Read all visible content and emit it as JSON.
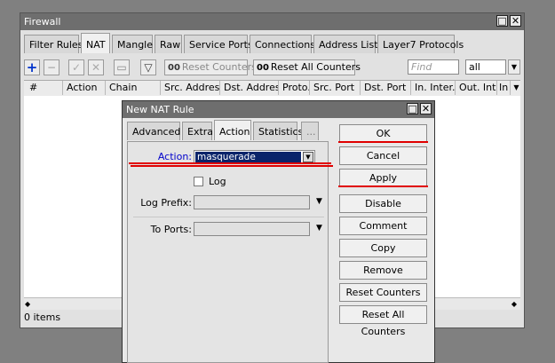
{
  "main_window": {
    "title": "Firewall",
    "tabs": [
      {
        "label": "Filter Rules"
      },
      {
        "label": "NAT"
      },
      {
        "label": "Mangle"
      },
      {
        "label": "Raw"
      },
      {
        "label": "Service Ports"
      },
      {
        "label": "Connections"
      },
      {
        "label": "Address Lists"
      },
      {
        "label": "Layer7 Protocols"
      }
    ],
    "active_tab": "NAT",
    "toolbar": {
      "reset_counters": "Reset Counters",
      "reset_all_counters": "Reset All Counters",
      "counter_prefix": "00",
      "find_placeholder": "Find",
      "filter_value": "all"
    },
    "columns": [
      "#",
      "Action",
      "Chain",
      "Src. Address",
      "Dst. Address",
      "Proto...",
      "Src. Port",
      "Dst. Port",
      "In. Inter...",
      "Out. Int...",
      "In"
    ],
    "status": "0 items"
  },
  "dialog": {
    "title": "New NAT Rule",
    "tabs": [
      {
        "label": "Advanced"
      },
      {
        "label": "Extra"
      },
      {
        "label": "Action"
      },
      {
        "label": "Statistics"
      },
      {
        "label": "..."
      }
    ],
    "active_tab": "Action",
    "action_label": "Action:",
    "action_value": "masquerade",
    "log_label": "Log",
    "log_checked": false,
    "log_prefix_label": "Log Prefix:",
    "to_ports_label": "To Ports:",
    "buttons": [
      "OK",
      "Cancel",
      "Apply",
      "Disable",
      "Comment",
      "Copy",
      "Remove",
      "Reset Counters",
      "Reset All Counters"
    ]
  },
  "colors": {
    "highlight_red": "#e00000",
    "selection_blue": "#0a246a",
    "label_blue": "#0000cc"
  }
}
